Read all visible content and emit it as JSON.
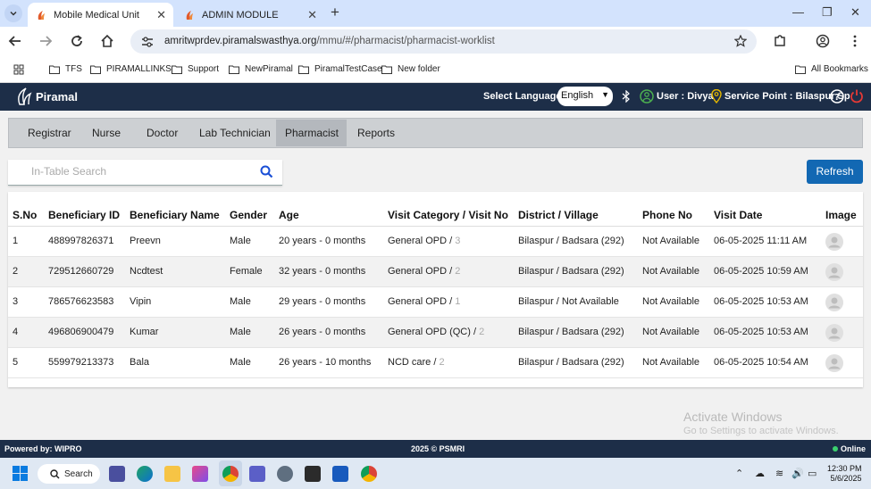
{
  "browser": {
    "tabs": [
      {
        "title": "Mobile Medical Unit",
        "active": true
      },
      {
        "title": "ADMIN MODULE",
        "active": false
      }
    ],
    "url_host": "amritwprdev.piramalswasthya.org",
    "url_path": "/mmu/#/pharmacist/pharmacist-worklist",
    "bookmarks": [
      "TFS",
      "PIRAMALLINKS",
      "Support",
      "NewPiramal",
      "PiramalTestCase",
      "New folder"
    ],
    "all_bookmarks": "All Bookmarks"
  },
  "header": {
    "brand": "Piramal",
    "lang_label": "Select Language:",
    "lang_value": "English",
    "user_text": "User : Divya",
    "service_point": "Service Point : Bilaspur Sp"
  },
  "menu": [
    "Registrar",
    "Nurse",
    "Doctor",
    "Lab Technician",
    "Pharmacist",
    "Reports"
  ],
  "menu_active": "Pharmacist",
  "search": {
    "placeholder": "In-Table Search"
  },
  "refresh_label": "Refresh",
  "table": {
    "headers": [
      "S.No",
      "Beneficiary ID",
      "Beneficiary Name",
      "Gender",
      "Age",
      "Visit Category / Visit No",
      "District / Village",
      "Phone No",
      "Visit Date",
      "Image"
    ],
    "rows": [
      {
        "sno": "1",
        "id": "488997826371",
        "name": "Preevn",
        "gender": "Male",
        "age": "20 years - 0 months",
        "category": "General OPD / ",
        "visit_no": "3",
        "district": "Bilaspur / Badsara (292)",
        "phone": "Not Available",
        "date": "06-05-2025 11:11 AM"
      },
      {
        "sno": "2",
        "id": "729512660729",
        "name": "Ncdtest",
        "gender": "Female",
        "age": "32 years - 0 months",
        "category": "General OPD / ",
        "visit_no": "2",
        "district": "Bilaspur / Badsara (292)",
        "phone": "Not Available",
        "date": "06-05-2025 10:59 AM"
      },
      {
        "sno": "3",
        "id": "786576623583",
        "name": "Vipin",
        "gender": "Male",
        "age": "29 years - 0 months",
        "category": "General OPD / ",
        "visit_no": "1",
        "district": "Bilaspur / Not Available",
        "phone": "Not Available",
        "date": "06-05-2025 10:53 AM"
      },
      {
        "sno": "4",
        "id": "496806900479",
        "name": "Kumar",
        "gender": "Male",
        "age": "26 years - 0 months",
        "category": "General OPD (QC) / ",
        "visit_no": "2",
        "district": "Bilaspur / Badsara (292)",
        "phone": "Not Available",
        "date": "06-05-2025 10:53 AM"
      },
      {
        "sno": "5",
        "id": "559979213373",
        "name": "Bala",
        "gender": "Male",
        "age": "26 years - 10 months",
        "category": "NCD care / ",
        "visit_no": "2",
        "district": "Bilaspur / Badsara (292)",
        "phone": "Not Available",
        "date": "06-05-2025 10:54 AM"
      }
    ]
  },
  "watermark": {
    "line1": "Activate Windows",
    "line2": "Go to Settings to activate Windows."
  },
  "footer": {
    "left": "Powered by: WIPRO",
    "center": "2025 © PSMRI",
    "status": "Online"
  },
  "taskbar": {
    "search_label": "Search",
    "time": "12:30 PM",
    "date": "5/6/2025"
  },
  "colors": {
    "appbar": "#1d2e48",
    "accent": "#1268b3",
    "tabstrip": "#d3e3fd"
  }
}
